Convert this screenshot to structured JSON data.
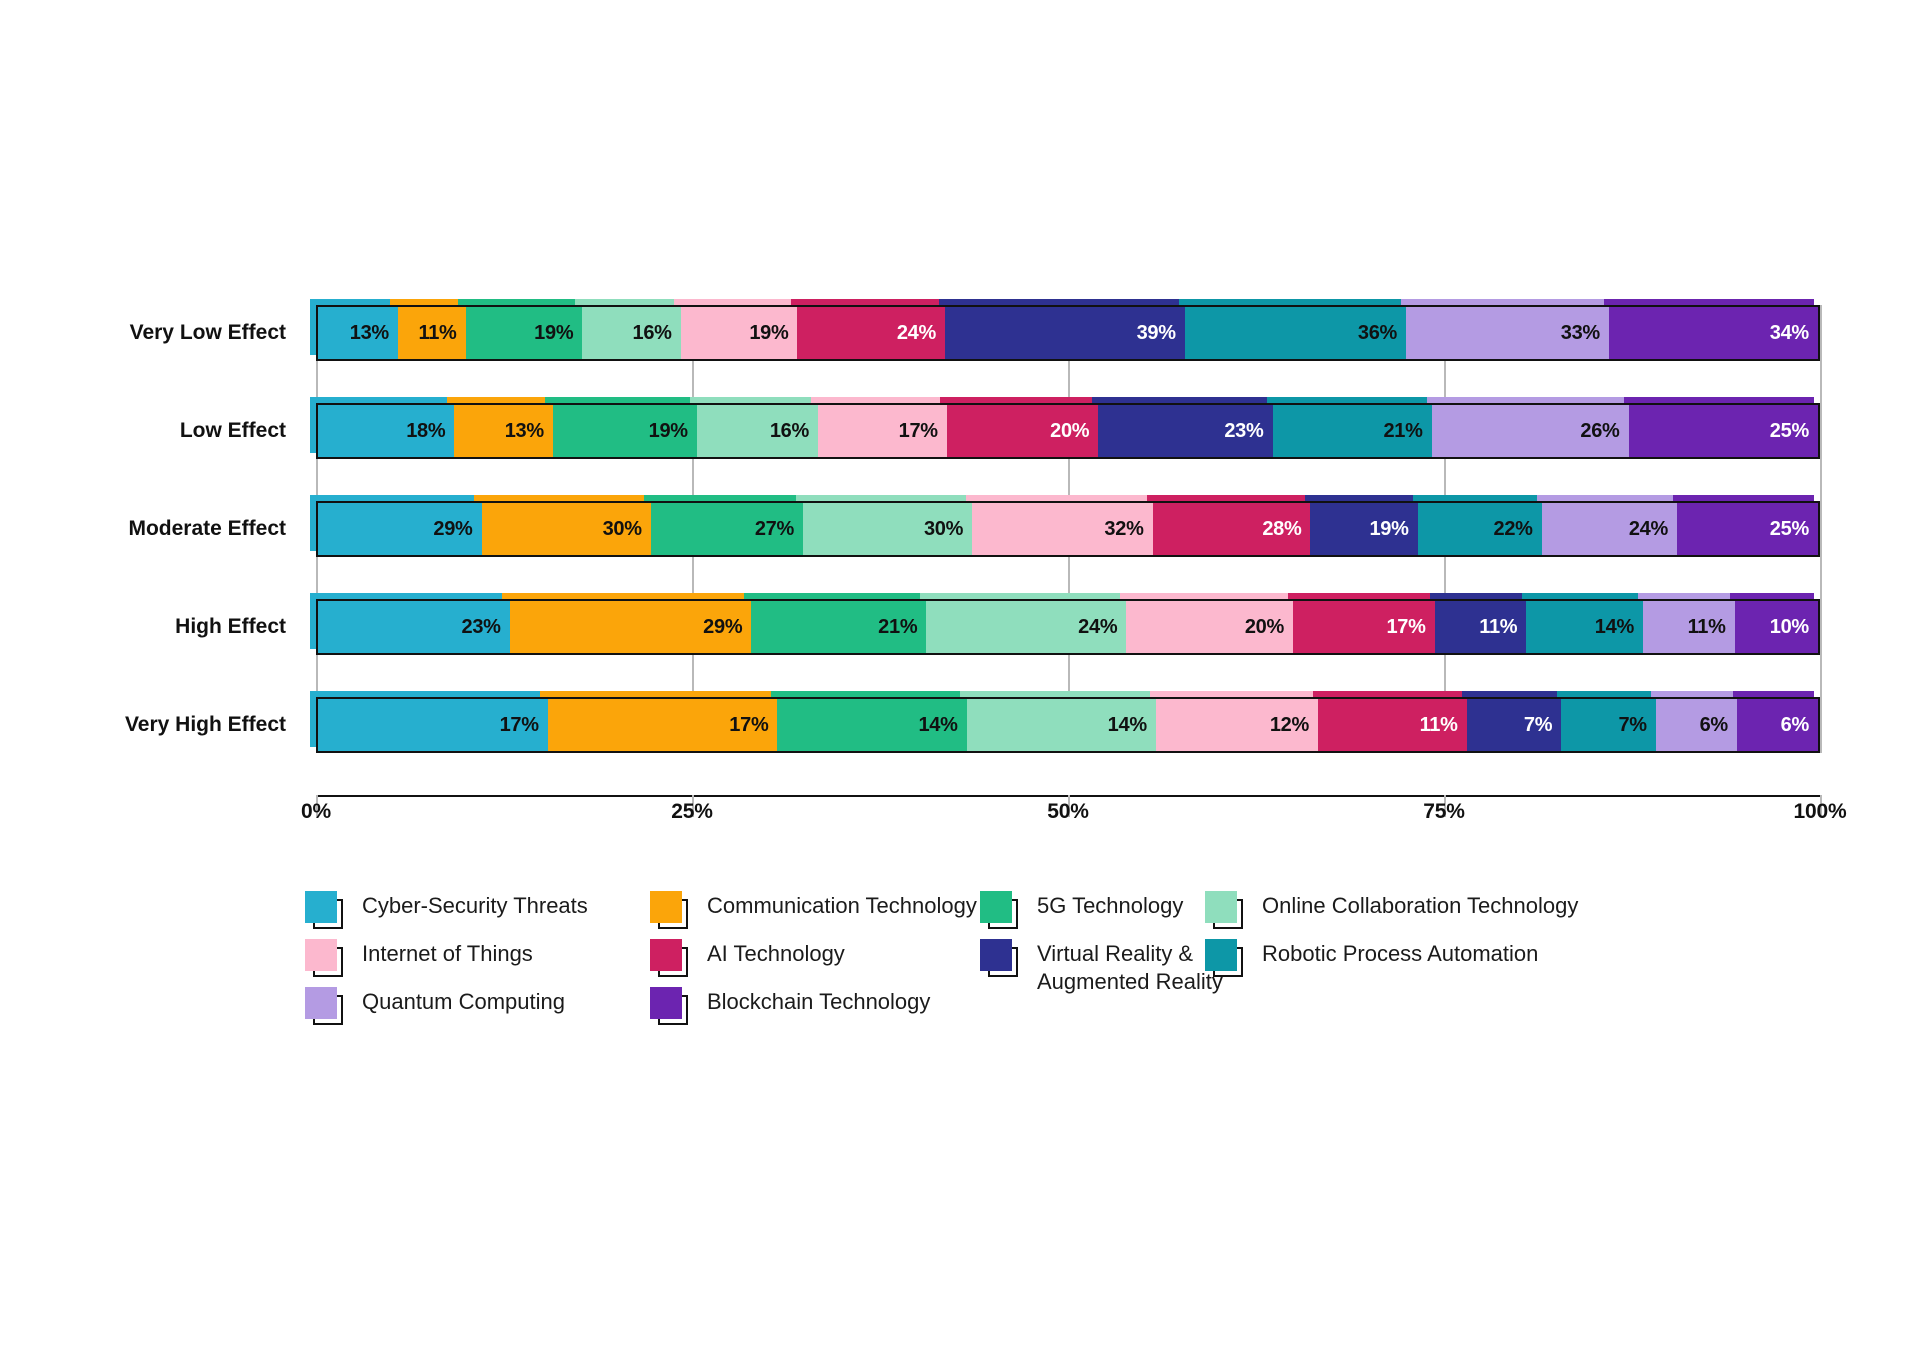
{
  "chart_data": {
    "type": "bar",
    "subtype": "100% stacked horizontal bar",
    "title": "",
    "xlabel": "",
    "ylabel": "",
    "xlim": [
      0,
      100
    ],
    "grid": true,
    "legend_position": "bottom",
    "xtick_labels": [
      "0%",
      "25%",
      "50%",
      "75%",
      "100%"
    ],
    "xtick_values": [
      0,
      25,
      50,
      75,
      100
    ],
    "categories": [
      "Very Low Effect",
      "Low Effect",
      "Moderate Effect",
      "High Effect",
      "Very High Effect"
    ],
    "series": [
      {
        "name": "Cyber-Security Threats",
        "color": "#26AFCF",
        "values": [
          13,
          18,
          29,
          23,
          17
        ]
      },
      {
        "name": "Communication Technology",
        "color": "#FBA50A",
        "values": [
          11,
          13,
          30,
          29,
          17
        ]
      },
      {
        "name": "5G Technology",
        "color": "#21BD84",
        "values": [
          19,
          19,
          27,
          21,
          14
        ]
      },
      {
        "name": "Online Collaboration Technology",
        "color": "#8FDEBD",
        "values": [
          16,
          16,
          30,
          24,
          14
        ]
      },
      {
        "name": "Internet of Things",
        "color": "#FCB8CE",
        "values": [
          19,
          17,
          32,
          20,
          12
        ]
      },
      {
        "name": "AI Technology",
        "color": "#CE2061",
        "values": [
          24,
          20,
          28,
          17,
          11
        ]
      },
      {
        "name": "Virtual Reality &\nAugmented Reality",
        "color": "#2E3191",
        "values": [
          39,
          23,
          19,
          11,
          7
        ]
      },
      {
        "name": "Robotic Process Automation",
        "color": "#0D97A7",
        "values": [
          36,
          21,
          22,
          14,
          7
        ]
      },
      {
        "name": "Quantum Computing",
        "color": "#B49BE3",
        "values": [
          33,
          26,
          24,
          11,
          6
        ]
      },
      {
        "name": "Blockchain Technology",
        "color": "#6C24B0",
        "values": [
          34,
          25,
          25,
          10,
          6
        ]
      }
    ],
    "label_text_colors": [
      [
        "#111111",
        "#111111",
        "#111111",
        "#111111",
        "#111111",
        "#ffffff",
        "#ffffff",
        "#111111",
        "#111111",
        "#ffffff"
      ],
      [
        "#111111",
        "#111111",
        "#111111",
        "#111111",
        "#111111",
        "#ffffff",
        "#ffffff",
        "#111111",
        "#111111",
        "#ffffff"
      ],
      [
        "#111111",
        "#111111",
        "#111111",
        "#111111",
        "#111111",
        "#ffffff",
        "#ffffff",
        "#111111",
        "#111111",
        "#ffffff"
      ],
      [
        "#111111",
        "#111111",
        "#111111",
        "#111111",
        "#111111",
        "#ffffff",
        "#ffffff",
        "#111111",
        "#111111",
        "#ffffff"
      ],
      [
        "#111111",
        "#111111",
        "#111111",
        "#111111",
        "#111111",
        "#ffffff",
        "#ffffff",
        "#111111",
        "#111111",
        "#ffffff"
      ]
    ],
    "bar_labels": [
      [
        "13%",
        "11%",
        "19%",
        "16%",
        "19%",
        "24%",
        "39%",
        "36%",
        "33%",
        "34%"
      ],
      [
        "18%",
        "13%",
        "19%",
        "16%",
        "17%",
        "20%",
        "23%",
        "21%",
        "26%",
        "25%"
      ],
      [
        "29%",
        "30%",
        "27%",
        "30%",
        "32%",
        "28%",
        "19%",
        "22%",
        "24%",
        "25%"
      ],
      [
        "23%",
        "29%",
        "21%",
        "24%",
        "20%",
        "17%",
        "11%",
        "14%",
        "11%",
        "10%"
      ],
      [
        "17%",
        "17%",
        "14%",
        "14%",
        "12%",
        "11%",
        "7%",
        "7%",
        "6%",
        "6%"
      ]
    ]
  },
  "legend": {
    "items": [
      {
        "label": "Cyber-Security Threats",
        "color": "#26AFCF"
      },
      {
        "label": "Communication Technology",
        "color": "#FBA50A"
      },
      {
        "label": "5G Technology",
        "color": "#21BD84"
      },
      {
        "label": "Online Collaboration Technology",
        "color": "#8FDEBD"
      },
      {
        "label": "Internet of Things",
        "color": "#FCB8CE"
      },
      {
        "label": "AI Technology",
        "color": "#CE2061"
      },
      {
        "label": "Virtual Reality &\nAugmented Reality",
        "color": "#2E3191"
      },
      {
        "label": "Robotic Process Automation",
        "color": "#0D97A7"
      },
      {
        "label": "Quantum Computing",
        "color": "#B49BE3"
      },
      {
        "label": "Blockchain Technology",
        "color": "#6C24B0"
      }
    ]
  },
  "style": {
    "background": "#ffffff",
    "outline": "#111111",
    "gridline": "#b9b9b9",
    "axis": "#111111",
    "text": "#111111"
  }
}
